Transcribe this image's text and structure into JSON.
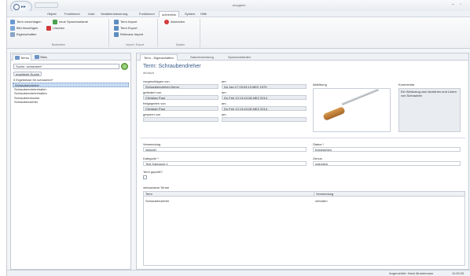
{
  "window": {
    "title": "doxygkdn"
  },
  "menu": [
    "Objekt",
    "Funktionen",
    "Liste",
    "Variablensteuerung",
    "Funktionen",
    "authentisk",
    "System",
    "Hilfe"
  ],
  "ribbon": {
    "groups": [
      {
        "label": "Bearbeiten",
        "buttons": [
          "Term vorschlagen",
          "neue Sprachvariante",
          "Bild hinzufügen",
          "Löschen",
          "Eigenschaften"
        ]
      },
      {
        "label": "Import / Export",
        "buttons": [
          "Term Import",
          "Term Export",
          "Relevanz Import"
        ]
      },
      {
        "label": "System",
        "buttons": [
          "Abmelden"
        ]
      }
    ]
  },
  "left": {
    "tabs": [
      "Terms",
      "Sites"
    ],
    "search_value": "Suche: schrauben*",
    "extended_search": "erweiterte Suche",
    "result_count": "5 Ergebnisse für schrauben*",
    "results": [
      "Schraubendreher",
      "Schraubendrehrehalter",
      "Schraubendrehrehalten",
      "Schraubendrucker",
      "Schraubenzieher"
    ]
  },
  "main": {
    "tabs": [
      "Term - Eigenschaften",
      "Satzverwendung",
      "Sprachvarianten"
    ],
    "term_heading": "Term: Schraubendreher",
    "language": "deutsch",
    "fields": {
      "suggested_by_label": "vorgeschlagen von",
      "suggested_at_label": "am",
      "suggested_by": "Schraubendreher-Demo",
      "suggested_at": "Do Jan 17 03:03:13 MEZ 1970",
      "changed_by_label": "geändert von",
      "changed_at_label": "am",
      "changed_by": "Christian Paul",
      "changed_at": "Do Feb 13 13:43:28 MEZ 2014",
      "released_by_label": "freigegeben von",
      "released_at_label": "am",
      "released_by": "Christian Paul",
      "released_at": "Do Feb 13 13:43:28 MEZ 2014",
      "locked_by_label": "gesperrt von",
      "locked_at_label": "am",
      "locked_by": "",
      "locked_at": "",
      "image_label": "Abbildung",
      "comment_label": "Kommentar",
      "comment": "Ein Werkzeug zum Anziehen und Lösen von Schrauben",
      "usage_label": "Verwendung",
      "usage": "inkludet",
      "status_label": "Status *",
      "status": "freigegeben",
      "category_label": "Kategorie *",
      "category": "Test Kategorie 1",
      "genus_label": "Genus",
      "genus": "männlich",
      "checked_label": "Term geprüft?",
      "related_label": "verbundene Terme"
    },
    "related_grid": {
      "headers": [
        "Term",
        "Verwendung"
      ],
      "rows": [
        {
          "term": "Schraubenzieher",
          "usage": "verboten"
        }
      ]
    }
  },
  "status": {
    "user": "Angemeldet: Hans Mustermann",
    "time": "11:00:20"
  }
}
